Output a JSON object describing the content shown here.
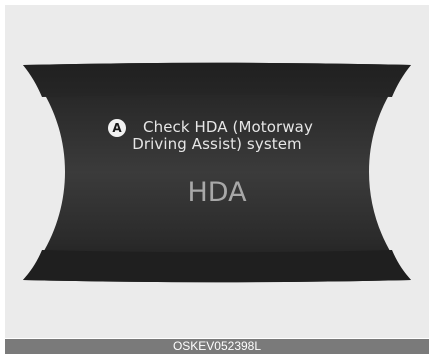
{
  "display": {
    "marker": "A",
    "message_line1": "Check HDA (Motorway",
    "message_line2": "Driving Assist) system",
    "indicator": "HDA"
  },
  "caption": "OSKEV052398L",
  "colors": {
    "frame_background": "#ebebeb",
    "panel_dark": "#1e1e1e",
    "panel_light": "#3a3a3a",
    "text_primary": "#e6e6e6",
    "text_indicator": "#a8a8a8",
    "caption_bar": "#7a7a7a"
  }
}
